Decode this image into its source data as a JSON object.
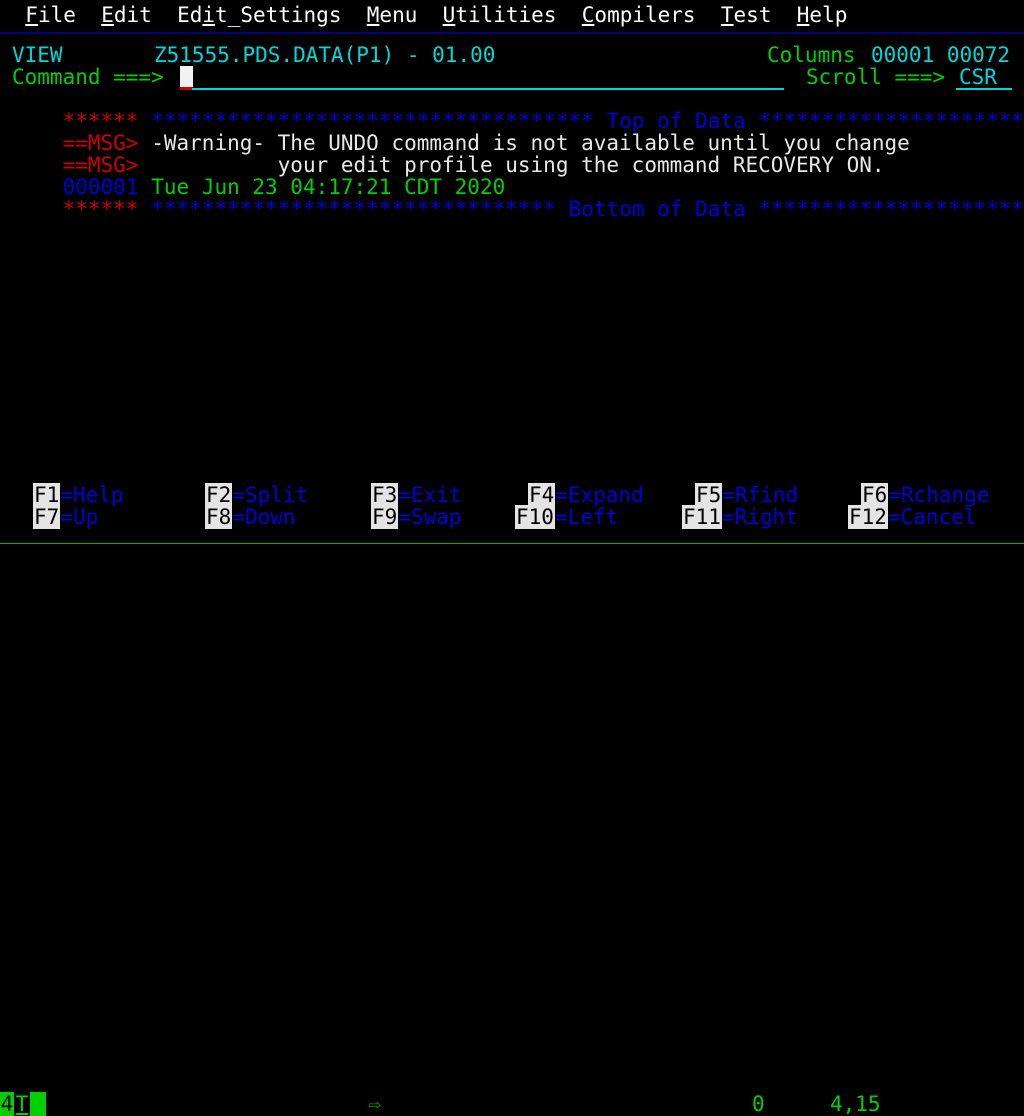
{
  "menubar": {
    "items": [
      {
        "label": "File",
        "mnemonic_index": 0
      },
      {
        "label": "Edit",
        "mnemonic_index": 0
      },
      {
        "label": "Edit_Settings",
        "mnemonic_index": 2
      },
      {
        "label": "Menu",
        "mnemonic_index": 0
      },
      {
        "label": "Utilities",
        "mnemonic_index": 0
      },
      {
        "label": "Compilers",
        "mnemonic_index": 0
      },
      {
        "label": "Test",
        "mnemonic_index": 0
      },
      {
        "label": "Help",
        "mnemonic_index": 0
      }
    ]
  },
  "header": {
    "mode": "VIEW",
    "dataset": "Z51555.PDS.DATA(P1) - 01.00",
    "columns_label": "Columns",
    "columns_value": "00001 00072",
    "command_label": "Command ===>",
    "command_value": "",
    "scroll_label": "Scroll ===>",
    "scroll_value": "CSR"
  },
  "body": {
    "top_of_data_prefix_asterisks": "******",
    "top_of_data_left_fill": "***********************************",
    "top_of_data_label": "Top of Data",
    "top_of_data_right_fill": "**************************",
    "messages": [
      {
        "tag": "==MSG>",
        "text": "-Warning- The UNDO command is not available until you change"
      },
      {
        "tag": "==MSG>",
        "text": "          your edit profile using the command RECOVERY ON."
      }
    ],
    "lines": [
      {
        "number": "000001",
        "text": "Tue Jun 23 04:17:21 CDT 2020"
      }
    ],
    "bottom_of_data_prefix_asterisks": "******",
    "bottom_of_data_left_fill": "********************************",
    "bottom_of_data_label": "Bottom of Data",
    "bottom_of_data_right_fill": "**************************"
  },
  "function_keys": [
    {
      "key": "F1",
      "label": "=Help"
    },
    {
      "key": "F2",
      "label": "=Split"
    },
    {
      "key": "F3",
      "label": "=Exit"
    },
    {
      "key": "F4",
      "label": "=Expand"
    },
    {
      "key": "F5",
      "label": "=Rfind"
    },
    {
      "key": "F6",
      "label": "=Rchange"
    },
    {
      "key": "F7",
      "label": "=Up"
    },
    {
      "key": "F8",
      "label": "=Down"
    },
    {
      "key": "F9",
      "label": "=Swap"
    },
    {
      "key": "F10",
      "label": "=Left"
    },
    {
      "key": "F11",
      "label": "=Right"
    },
    {
      "key": "F12",
      "label": "=Cancel"
    }
  ],
  "statusbar": {
    "session_number": "4",
    "terminal_indicator": "T",
    "arrow_icon": "⇨",
    "counter": "0",
    "cursor_position": "4,15"
  },
  "colors": {
    "background": "#000000",
    "white": "#e8e8e8",
    "cyan": "#00d7d7",
    "green": "#00d000",
    "blue": "#0000d8",
    "red": "#d00000",
    "menu_divider": "#000080",
    "fkey_bg": "#e4e4e4"
  }
}
